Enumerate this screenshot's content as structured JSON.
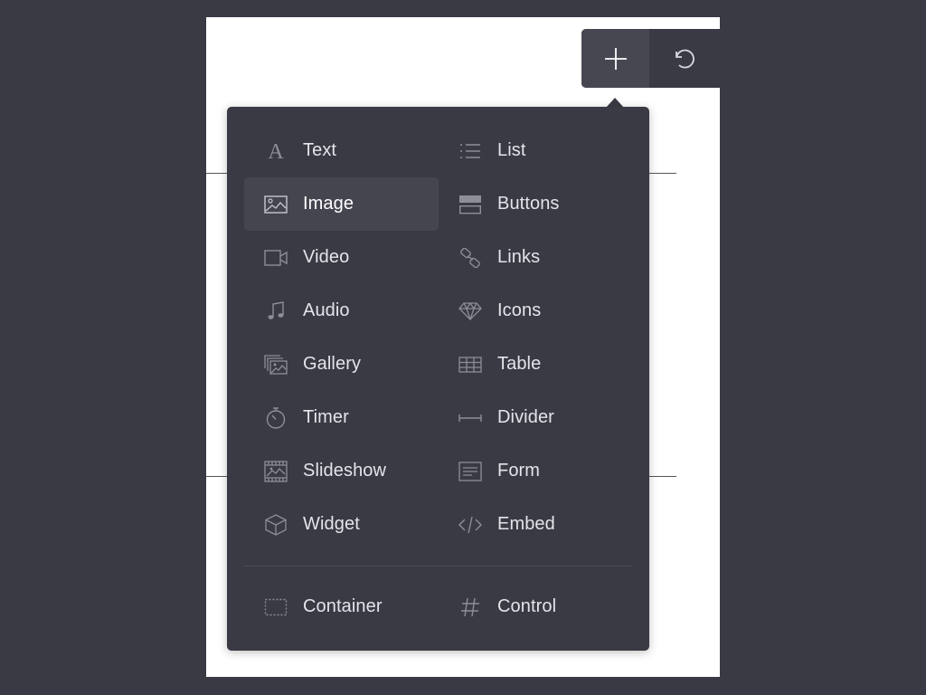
{
  "toolbar": {
    "add_icon": "plus-icon",
    "undo_icon": "undo-icon"
  },
  "menu": {
    "items": [
      {
        "label": "Text",
        "icon": "text-icon"
      },
      {
        "label": "List",
        "icon": "list-icon"
      },
      {
        "label": "Image",
        "icon": "image-icon",
        "selected": true
      },
      {
        "label": "Buttons",
        "icon": "buttons-icon"
      },
      {
        "label": "Video",
        "icon": "video-icon"
      },
      {
        "label": "Links",
        "icon": "links-icon"
      },
      {
        "label": "Audio",
        "icon": "audio-icon"
      },
      {
        "label": "Icons",
        "icon": "diamond-icon"
      },
      {
        "label": "Gallery",
        "icon": "gallery-icon"
      },
      {
        "label": "Table",
        "icon": "table-icon"
      },
      {
        "label": "Timer",
        "icon": "timer-icon"
      },
      {
        "label": "Divider",
        "icon": "divider-icon"
      },
      {
        "label": "Slideshow",
        "icon": "slideshow-icon"
      },
      {
        "label": "Form",
        "icon": "form-icon"
      },
      {
        "label": "Widget",
        "icon": "cube-icon"
      },
      {
        "label": "Embed",
        "icon": "code-icon"
      }
    ],
    "bottom_items": [
      {
        "label": "Container",
        "icon": "container-icon"
      },
      {
        "label": "Control",
        "icon": "hash-icon"
      }
    ]
  },
  "colors": {
    "background": "#3a3a44",
    "panel": "#3a3a44",
    "selected": "#45454f",
    "text": "#e4e4ea",
    "icon": "#8e8e98"
  }
}
